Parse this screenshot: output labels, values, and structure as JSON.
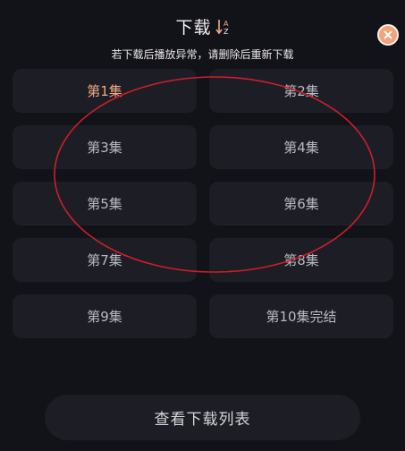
{
  "header": {
    "title": "下载",
    "sort_icon": "sort-az-icon",
    "notice": "若下载后播放异常，请删除后重新下载",
    "close_icon": "close-icon"
  },
  "episodes": [
    {
      "label": "第1集",
      "state": "downloading"
    },
    {
      "label": "第2集",
      "state": "available"
    },
    {
      "label": "第3集",
      "state": "available"
    },
    {
      "label": "第4集",
      "state": "available"
    },
    {
      "label": "第5集",
      "state": "available"
    },
    {
      "label": "第6集",
      "state": "available"
    },
    {
      "label": "第7集",
      "state": "available"
    },
    {
      "label": "第8集",
      "state": "available"
    },
    {
      "label": "第9集",
      "state": "available"
    },
    {
      "label": "第10集完结",
      "state": "available"
    }
  ],
  "footer": {
    "view_downloads_label": "查看下载列表"
  },
  "colors": {
    "background": "#121219",
    "card": "#1d1d26",
    "accent": "#f0a882",
    "annotation": "#cc1f2a"
  }
}
